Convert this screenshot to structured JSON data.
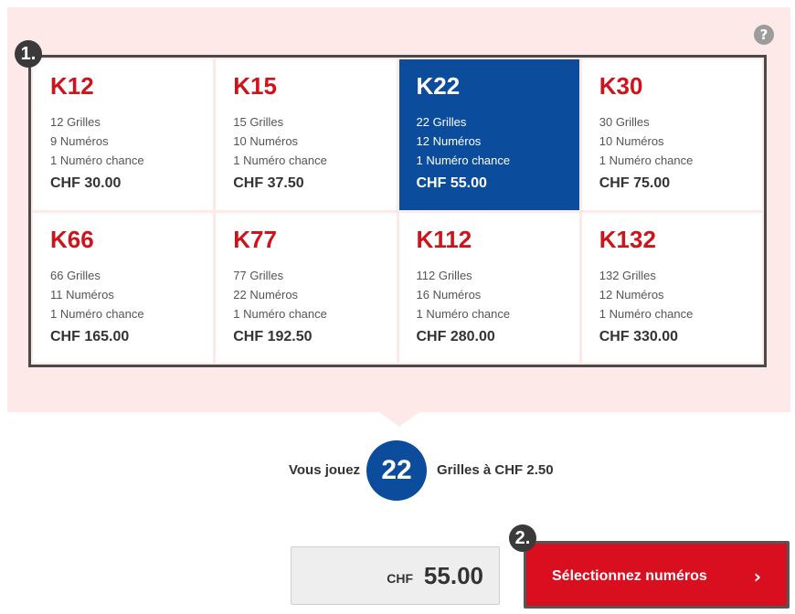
{
  "help_icon": "question-icon",
  "steps": {
    "one": "1.",
    "two": "2."
  },
  "packages": [
    {
      "code": "K12",
      "grilles": "12 Grilles",
      "numeros": "9 Numéros",
      "chance": "1 Numéro chance",
      "price": "CHF 30.00",
      "selected": false
    },
    {
      "code": "K15",
      "grilles": "15 Grilles",
      "numeros": "10 Numéros",
      "chance": "1 Numéro chance",
      "price": "CHF 37.50",
      "selected": false
    },
    {
      "code": "K22",
      "grilles": "22 Grilles",
      "numeros": "12 Numéros",
      "chance": "1 Numéro chance",
      "price": "CHF 55.00",
      "selected": true
    },
    {
      "code": "K30",
      "grilles": "30 Grilles",
      "numeros": "10 Numéros",
      "chance": "1 Numéro chance",
      "price": "CHF 75.00",
      "selected": false
    },
    {
      "code": "K66",
      "grilles": "66 Grilles",
      "numeros": "11 Numéros",
      "chance": "1 Numéro chance",
      "price": "CHF 165.00",
      "selected": false
    },
    {
      "code": "K77",
      "grilles": "77 Grilles",
      "numeros": "22 Numéros",
      "chance": "1 Numéro chance",
      "price": "CHF 192.50",
      "selected": false
    },
    {
      "code": "K112",
      "grilles": "112 Grilles",
      "numeros": "16 Numéros",
      "chance": "1 Numéro chance",
      "price": "CHF 280.00",
      "selected": false
    },
    {
      "code": "K132",
      "grilles": "132 Grilles",
      "numeros": "12 Numéros",
      "chance": "1 Numéro chance",
      "price": "CHF 330.00",
      "selected": false
    }
  ],
  "summary": {
    "pre": "Vous jouez",
    "count": "22",
    "post": "Grilles à CHF 2.50"
  },
  "total": {
    "currency": "CHF",
    "amount": "55.00"
  },
  "cta": {
    "label": "Sélectionnez numéros",
    "icon": "chevron-right-icon"
  },
  "colors": {
    "brand_red": "#d90e1e",
    "code_red": "#d0121b",
    "selected_blue": "#0c4c9c",
    "panel_pink": "#fce9e8"
  }
}
